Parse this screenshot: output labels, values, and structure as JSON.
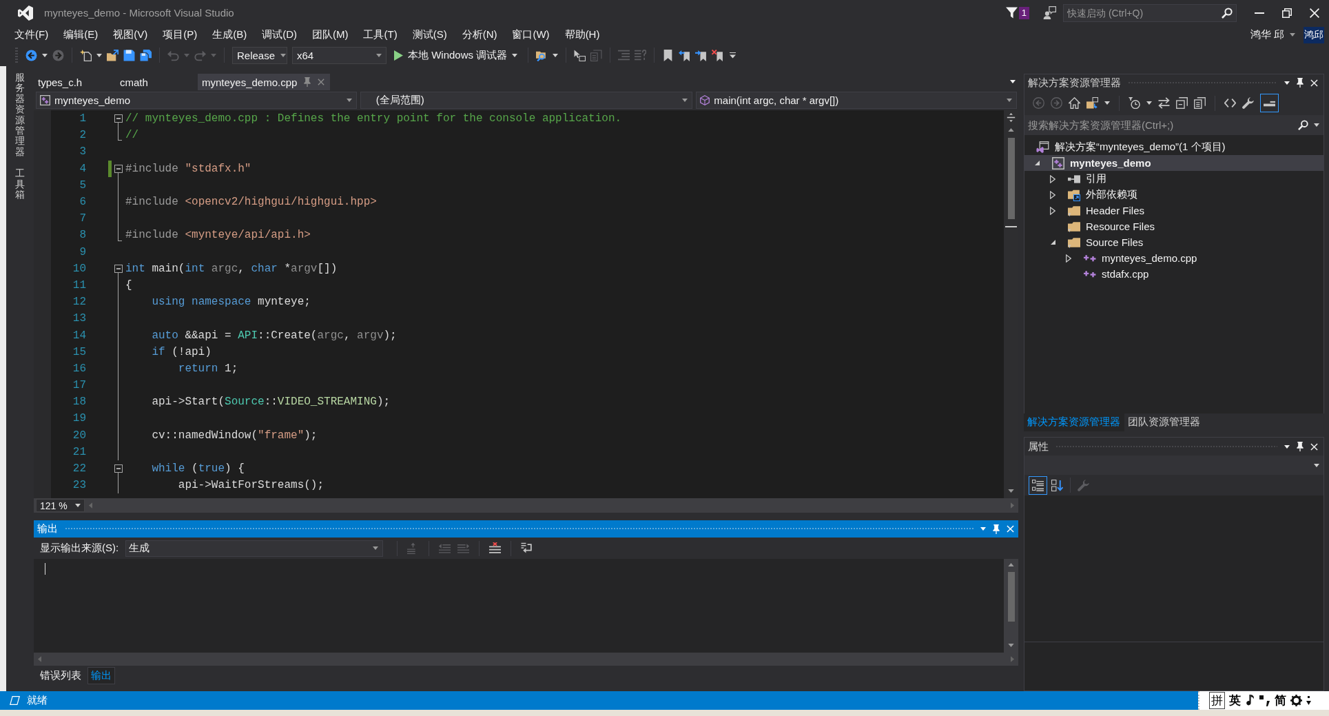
{
  "title_bar": {
    "title": "mynteyes_demo - Microsoft Visual Studio",
    "notification_count": "1",
    "quick_launch": {
      "placeholder": "快速启动 (Ctrl+Q)"
    }
  },
  "menu": [
    "文件(F)",
    "编辑(E)",
    "视图(V)",
    "项目(P)",
    "生成(B)",
    "调试(D)",
    "团队(M)",
    "工具(T)",
    "测试(S)",
    "分析(N)",
    "窗口(W)",
    "帮助(H)"
  ],
  "account": {
    "name": "鸿华 邱",
    "initials": "鸿邱"
  },
  "toolbar": {
    "left_buttons": [
      {
        "disabled": false
      },
      {
        "disabled": true
      },
      {
        "disabled": false
      },
      {
        "disabled": false
      },
      {
        "disabled": false
      },
      {
        "disabled": false
      },
      {
        "disabled": true
      },
      {
        "disabled": true
      }
    ],
    "configuration": "Release",
    "platform": "x64",
    "debug_target": "本地 Windows 调试器",
    "right_buttons": [
      {
        "disabled": false
      },
      {
        "disabled": false
      },
      {
        "disabled": true
      },
      {
        "disabled": true
      },
      {
        "disabled": true
      },
      {
        "disabled": false
      },
      {
        "disabled": false
      },
      {
        "disabled": false
      },
      {
        "disabled": false
      }
    ]
  },
  "side_tabs": [
    "服务器资源管理器",
    "工具箱"
  ],
  "editor": {
    "tabs": [
      {
        "label": "types_c.h",
        "selected": false
      },
      {
        "label": "cmath",
        "selected": false
      },
      {
        "label": "mynteyes_demo.cpp",
        "selected": true
      }
    ],
    "navigation": {
      "project": "mynteyes_demo",
      "scope": "(全局范围)",
      "member": "main(int argc, char * argv[])"
    },
    "lines": [
      {
        "number": "1",
        "kind": "region_start",
        "changed": false,
        "tokens": [
          {
            "kind": "comment",
            "text": "// mynteyes_demo.cpp : Defines the entry point for the console application."
          }
        ]
      },
      {
        "number": "2",
        "kind": "region_end",
        "changed": false,
        "tokens": [
          {
            "kind": "comment",
            "text": "//"
          }
        ]
      },
      {
        "number": "3",
        "kind": "plain",
        "changed": false
      },
      {
        "number": "4",
        "kind": "region_start",
        "changed": true,
        "tokens": [
          {
            "kind": "preprocessor",
            "text": "#include "
          },
          {
            "kind": "string",
            "text": "\"stdafx.h\""
          }
        ]
      },
      {
        "number": "5",
        "kind": "region_line",
        "changed": false
      },
      {
        "number": "6",
        "kind": "region_line",
        "changed": false,
        "tokens": [
          {
            "kind": "preprocessor",
            "text": "#include "
          },
          {
            "kind": "string",
            "text": "<opencv2/highgui/highgui.hpp>"
          }
        ]
      },
      {
        "number": "7",
        "kind": "region_line",
        "changed": false
      },
      {
        "number": "8",
        "kind": "region_end",
        "changed": false,
        "tokens": [
          {
            "kind": "preprocessor",
            "text": "#include "
          },
          {
            "kind": "string",
            "text": "<mynteye/api/api.h>"
          }
        ]
      },
      {
        "number": "9",
        "kind": "plain",
        "changed": false
      },
      {
        "number": "10",
        "kind": "region_start",
        "changed": false,
        "tokens": [
          {
            "kind": "keyword",
            "text": "int"
          },
          {
            "kind": "plain",
            "text": " main("
          },
          {
            "kind": "keyword",
            "text": "int"
          },
          {
            "kind": "param",
            "text": " argc"
          },
          {
            "kind": "plain",
            "text": ", "
          },
          {
            "kind": "keyword",
            "text": "char"
          },
          {
            "kind": "plain",
            "text": " *"
          },
          {
            "kind": "param",
            "text": "argv"
          },
          {
            "kind": "plain",
            "text": "[])"
          }
        ]
      },
      {
        "number": "11",
        "kind": "region_line",
        "changed": false,
        "tokens": [
          {
            "kind": "plain",
            "text": "{"
          }
        ]
      },
      {
        "number": "12",
        "kind": "region_line",
        "changed": false,
        "tokens": [
          {
            "kind": "keyword",
            "text": "    using"
          },
          {
            "kind": "keyword",
            "text": " namespace"
          },
          {
            "kind": "plain",
            "text": " mynteye;"
          }
        ]
      },
      {
        "number": "13",
        "kind": "region_line",
        "changed": false
      },
      {
        "number": "14",
        "kind": "region_line",
        "changed": false,
        "tokens": [
          {
            "kind": "keyword",
            "text": "    auto"
          },
          {
            "kind": "plain",
            "text": " &&api = "
          },
          {
            "kind": "type",
            "text": "API"
          },
          {
            "kind": "plain",
            "text": "::Create("
          },
          {
            "kind": "param",
            "text": "argc"
          },
          {
            "kind": "plain",
            "text": ", "
          },
          {
            "kind": "param",
            "text": "argv"
          },
          {
            "kind": "plain",
            "text": ");"
          }
        ]
      },
      {
        "number": "15",
        "kind": "region_line",
        "changed": false,
        "tokens": [
          {
            "kind": "keyword",
            "text": "    if"
          },
          {
            "kind": "plain",
            "text": " (!api)"
          }
        ]
      },
      {
        "number": "16",
        "kind": "region_line",
        "changed": false,
        "tokens": [
          {
            "kind": "keyword",
            "text": "        return"
          },
          {
            "kind": "plain",
            "text": " 1;"
          }
        ]
      },
      {
        "number": "17",
        "kind": "region_line",
        "changed": false
      },
      {
        "number": "18",
        "kind": "region_line",
        "changed": false,
        "tokens": [
          {
            "kind": "plain",
            "text": "    api->Start("
          },
          {
            "kind": "type",
            "text": "Source"
          },
          {
            "kind": "plain",
            "text": "::"
          },
          {
            "kind": "enum",
            "text": "VIDEO_STREAMING"
          },
          {
            "kind": "plain",
            "text": ");"
          }
        ]
      },
      {
        "number": "19",
        "kind": "region_line",
        "changed": false
      },
      {
        "number": "20",
        "kind": "region_line",
        "changed": false,
        "tokens": [
          {
            "kind": "plain",
            "text": "    cv::namedWindow("
          },
          {
            "kind": "string",
            "text": "\"frame\""
          },
          {
            "kind": "plain",
            "text": ");"
          }
        ]
      },
      {
        "number": "21",
        "kind": "region_line",
        "changed": false
      },
      {
        "number": "22",
        "kind": "region_start",
        "changed": false,
        "tokens": [
          {
            "kind": "keyword",
            "text": "    while"
          },
          {
            "kind": "plain",
            "text": " ("
          },
          {
            "kind": "keyword",
            "text": "true"
          },
          {
            "kind": "plain",
            "text": ") {"
          }
        ]
      },
      {
        "number": "23",
        "kind": "region_line",
        "changed": false,
        "tokens": [
          {
            "kind": "plain",
            "text": "        api->WaitForStreams();"
          }
        ]
      }
    ],
    "zoom": "121 %"
  },
  "output": {
    "title": "输出",
    "source_label": "显示输出来源(S):",
    "source": "生成",
    "buttons": [
      {
        "disabled": true
      },
      {
        "disabled": true
      },
      {
        "disabled": true
      },
      {
        "disabled": false
      },
      {
        "disabled": false
      }
    ]
  },
  "bottom_tabs": [
    {
      "label": "错误列表",
      "selected": false
    },
    {
      "label": "输出",
      "selected": true
    }
  ],
  "solution_explorer": {
    "title": "解决方案资源管理器",
    "toolbar": [
      {
        "disabled": true,
        "pressed": false
      },
      {
        "disabled": true,
        "pressed": false
      },
      {
        "disabled": false,
        "pressed": false
      },
      {
        "disabled": false,
        "pressed": false
      },
      {
        "disabled": false,
        "pressed": false
      },
      {
        "disabled": false,
        "pressed": false
      },
      {
        "disabled": false,
        "pressed": false
      },
      {
        "disabled": false,
        "pressed": false
      },
      {
        "disabled": false,
        "pressed": false
      },
      {
        "disabled": false,
        "pressed": false
      },
      {
        "disabled": false,
        "pressed": true
      }
    ],
    "search": {
      "placeholder": "搜索解决方案资源管理器(Ctrl+;)"
    },
    "tree": [
      {
        "label": "解决方案“mynteyes_demo”(1 个项目)",
        "kind": "solution",
        "selected": false,
        "children": [
          {
            "label": "mynteyes_demo",
            "kind": "project",
            "expanded": true,
            "selected": true,
            "children": [
              {
                "label": "引用",
                "kind": "references",
                "expanded": false,
                "selected": false
              },
              {
                "label": "外部依赖项",
                "kind": "external",
                "expanded": false,
                "selected": false
              },
              {
                "label": "Header Files",
                "kind": "folder",
                "expanded": false,
                "selected": false
              },
              {
                "label": "Resource Files",
                "kind": "folder",
                "selected": false
              },
              {
                "label": "Source Files",
                "kind": "folder",
                "expanded": true,
                "selected": false,
                "children": [
                  {
                    "label": "mynteyes_demo.cpp",
                    "kind": "cpp",
                    "expanded": false,
                    "selected": false
                  },
                  {
                    "label": "stdafx.cpp",
                    "kind": "cpp",
                    "selected": false
                  }
                ]
              }
            ]
          }
        ]
      }
    ]
  },
  "right_tabs": [
    {
      "label": "解决方案资源管理器",
      "selected": true
    },
    {
      "label": "团队资源管理器",
      "selected": false
    }
  ],
  "properties": {
    "title": "属性",
    "toolbar": [
      {
        "disabled": false,
        "pressed": true
      },
      {
        "disabled": false,
        "pressed": false
      },
      {
        "disabled": true,
        "pressed": false
      }
    ]
  },
  "status_bar": {
    "text": "就绪"
  },
  "ime_toolbar": {
    "input_mode": "拼",
    "language": "英",
    "script": "简"
  }
}
